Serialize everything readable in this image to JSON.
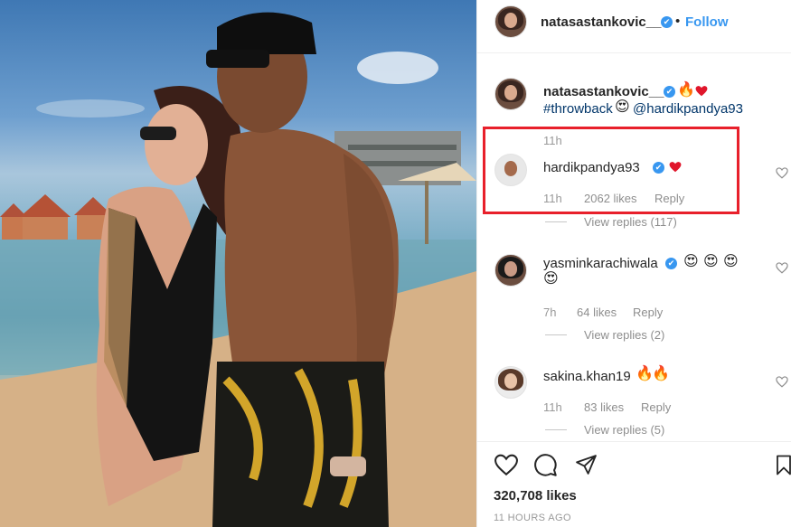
{
  "post_header": {
    "username": "natasastankovic__",
    "separator": "•",
    "follow_label": "Follow"
  },
  "caption": {
    "username": "natasastankovic__",
    "hashtag": "#throwback",
    "mention": "@hardikpandya93",
    "time": "11h",
    "emojis": [
      "fire",
      "red-heart",
      "heart-eyes"
    ]
  },
  "comments": [
    {
      "username": "hardikpandya93",
      "verified": true,
      "time": "11h",
      "likes": "2062 likes",
      "reply_label": "Reply",
      "view_replies": "View replies (117)",
      "emojis": [
        "red-heart"
      ],
      "highlighted": true
    },
    {
      "username": "yasminkarachiwala",
      "verified": true,
      "time": "7h",
      "likes": "64 likes",
      "reply_label": "Reply",
      "view_replies": "View replies (2)",
      "emojis": [
        "heart-eyes",
        "heart-eyes",
        "heart-eyes",
        "heart-eyes"
      ]
    },
    {
      "username": "sakina.khan19",
      "verified": false,
      "time": "11h",
      "likes": "83 likes",
      "reply_label": "Reply",
      "view_replies": "View replies (5)",
      "emojis": [
        "fire",
        "fire"
      ]
    }
  ],
  "actions": {
    "likes": "320,708 likes",
    "time_ago": "11 HOURS AGO"
  },
  "colors": {
    "accent_blue": "#3897f0",
    "link_dark": "#003569",
    "highlight_red": "#e8202b",
    "heart_red": "#e0162b"
  }
}
